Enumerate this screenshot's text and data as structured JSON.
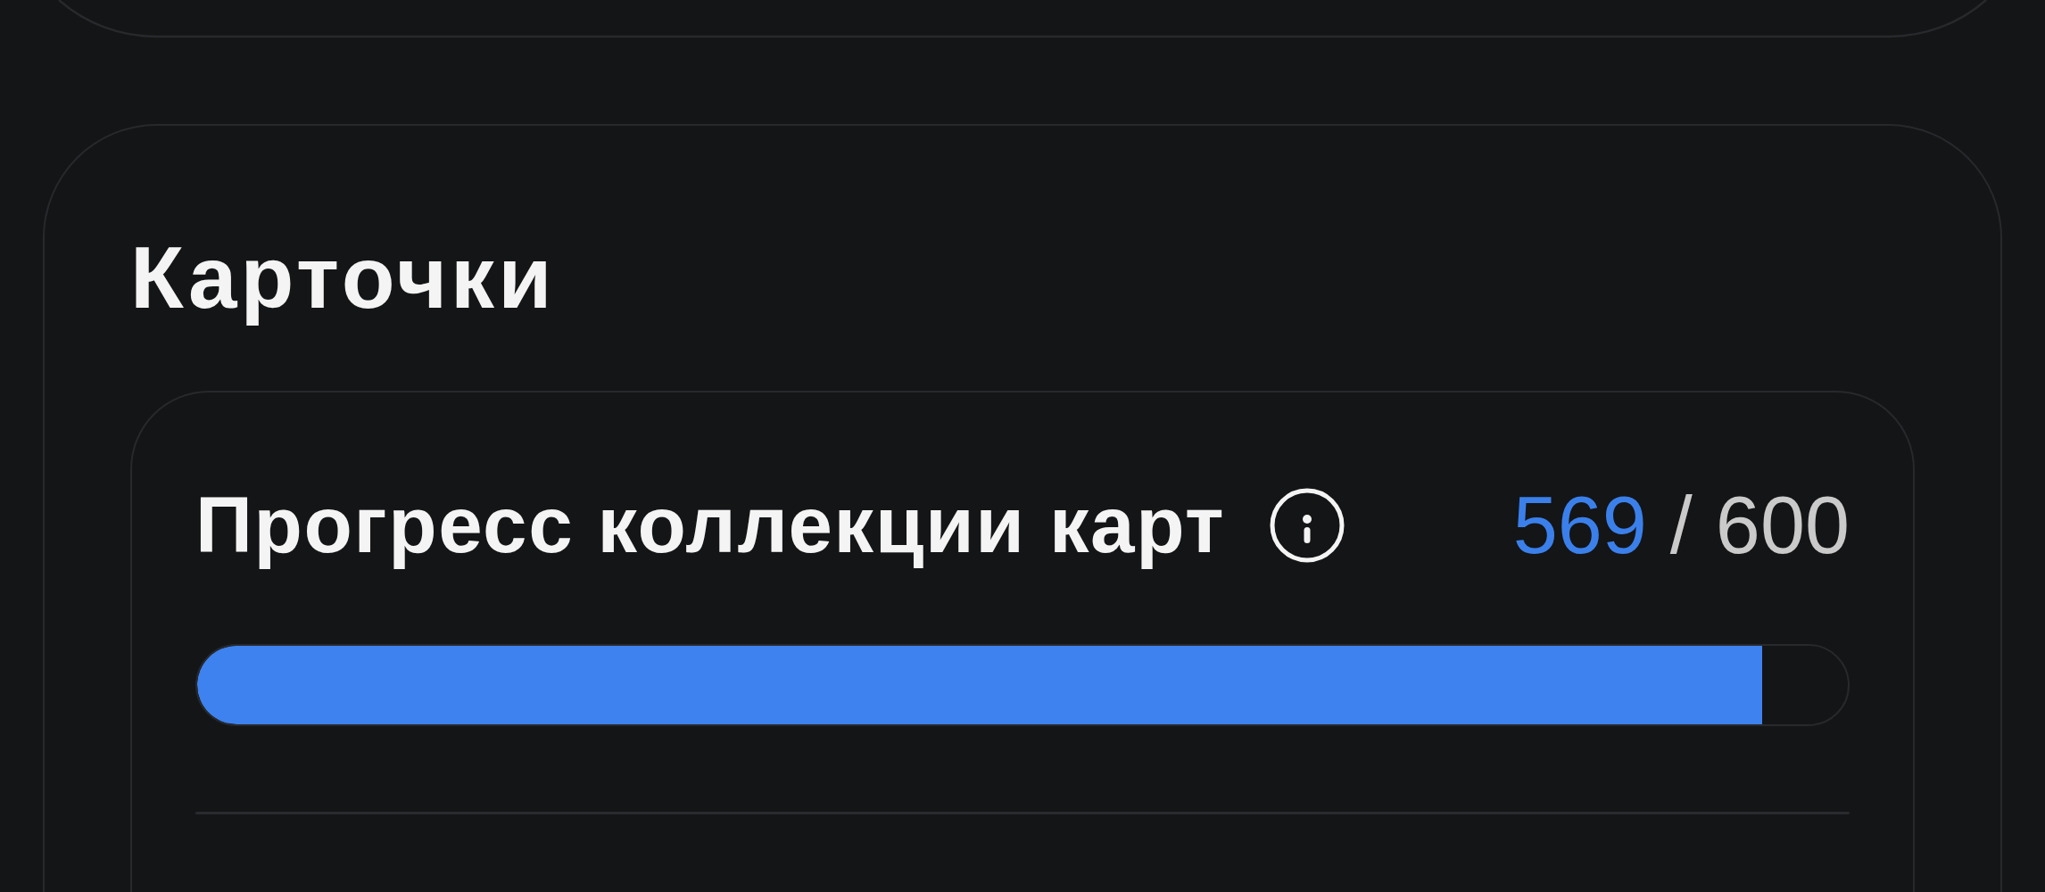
{
  "section": {
    "title": "Карточки"
  },
  "collection_progress": {
    "title": "Прогресс коллекции карт",
    "collected": "569",
    "separator": "/",
    "total": "600",
    "level": 0.948
  }
}
